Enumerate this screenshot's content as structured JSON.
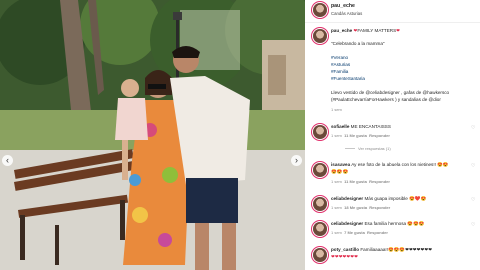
{
  "post": {
    "username": "pau_eche",
    "location": "Candás Asturias"
  },
  "caption": {
    "username": "pau_eche",
    "heading_text": "FAMILY MATTERS",
    "heading_emoji": "❤",
    "quote": "\"Celebrando a la mamma\"",
    "hashtags": [
      "#Verano",
      "#Asturias",
      "#Familia",
      "#FuenteSantaria"
    ],
    "credit_line1": "Llevo vestido de @celiabdesigner , gafas de @hawkersco",
    "credit_line2": "(#PaulaEchevarríaForHawkers ) y sandalias de @dior",
    "time": "1 sem"
  },
  "comments": [
    {
      "username": "sofiaelle",
      "text": "ME ENCANTAISSS",
      "time": "1 sem",
      "likes": "11 Me gusta",
      "reply": "Responder"
    },
    {
      "username": "isasavea",
      "text": "Ay ese foto de la abuela con los nietines!! 😍😍",
      "text2": "😍😍😍",
      "time": "1 sem",
      "likes": "11 Me gusta",
      "reply": "Responder"
    },
    {
      "username": "celiabdesigner",
      "text": "Más guapa imposible 😍❤️😍",
      "time": "1 sem",
      "likes": "18 Me gusta",
      "reply": "Responder"
    },
    {
      "username": "celiabdesigner",
      "text": "Esa familia hermosa 😍😍😍",
      "time": "1 sem",
      "likes": "7 Me gusta",
      "reply": "Responder"
    },
    {
      "username": "poty_castillo",
      "text": "Familiaaaaa!!😍😍😍❤❤❤❤❤❤❤",
      "text2": "❤❤❤❤❤❤❤",
      "time": "",
      "likes": "",
      "reply": ""
    }
  ],
  "view_replies": "Ver respuestas (1)",
  "icons": {
    "prev": "chevron-left-icon",
    "next": "chevron-right-icon",
    "like": "heart-icon"
  },
  "colors": {
    "link": "#00376b",
    "muted": "#8e8e8e",
    "ring": "#e1306c"
  }
}
